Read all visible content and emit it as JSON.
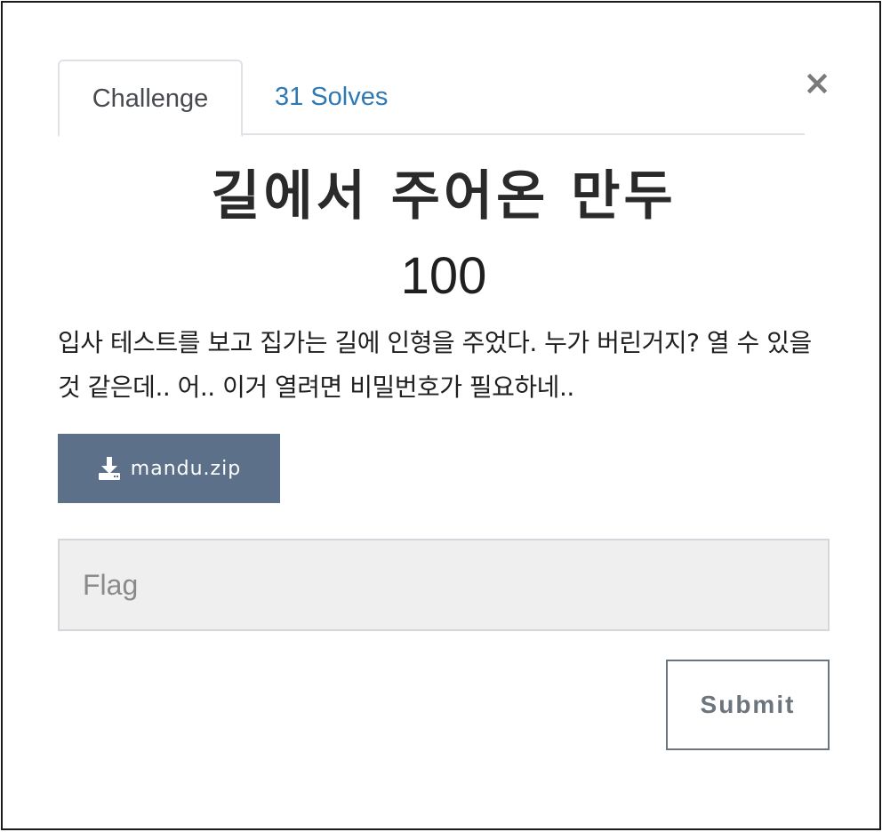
{
  "tabs": {
    "challenge_label": "Challenge",
    "solves_label": "31 Solves"
  },
  "close_label": "×",
  "challenge": {
    "name": "길에서 주어온 만두",
    "value": "100",
    "description": "입사 테스트를 보고 집가는 길에 인형을 주었다. 누가 버린거지? 열 수 있을 것 같은데.. 어.. 이거 열려면 비밀번호가 필요하네..",
    "file_label": "mandu.zip",
    "file_icon": "download-icon"
  },
  "form": {
    "flag_placeholder": "Flag",
    "submit_label": "Submit"
  },
  "colors": {
    "download_button": "#5d7089",
    "link": "#2e79b4",
    "input_bg": "#efefef"
  }
}
